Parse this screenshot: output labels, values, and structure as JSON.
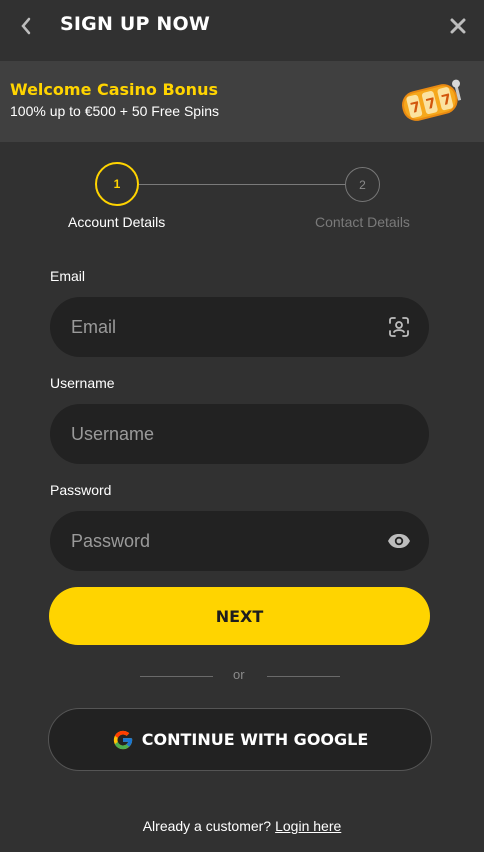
{
  "header": {
    "title": "SIGN UP NOW"
  },
  "banner": {
    "title": "Welcome Casino Bonus",
    "subtitle": "100% up to €500 + 50 Free Spins"
  },
  "stepper": {
    "steps": [
      {
        "number": "1",
        "label": "Account Details",
        "active": true
      },
      {
        "number": "2",
        "label": "Contact Details",
        "active": false
      }
    ]
  },
  "form": {
    "email": {
      "label": "Email",
      "placeholder": "Email",
      "value": ""
    },
    "username": {
      "label": "Username",
      "placeholder": "Username",
      "value": ""
    },
    "password": {
      "label": "Password",
      "placeholder": "Password",
      "value": ""
    },
    "next_label": "NEXT",
    "divider": "or",
    "google_label": "CONTINUE WITH GOOGLE"
  },
  "footer": {
    "prompt": "Already a customer?",
    "link": "Login here"
  },
  "colors": {
    "accent": "#ffd400",
    "background": "#313131",
    "field": "#222222"
  }
}
